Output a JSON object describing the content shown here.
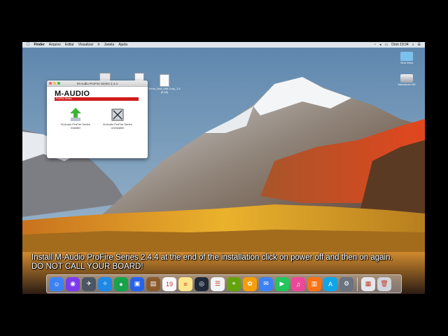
{
  "menubar": {
    "apple": "",
    "items": [
      "Finder",
      "Arquivo",
      "Editar",
      "Visualizar",
      "Ir",
      "Janela",
      "Ajuda"
    ],
    "clock": "Dom 19:34"
  },
  "desktop_icons": [
    {
      "label": "",
      "icon": "disk-image-icon"
    },
    {
      "label": "",
      "icon": "document-icon"
    },
    {
      "label": "Dmm_Bud_bb8.4.zip_1.5 (5,48)",
      "icon": "zip-icon"
    },
    {
      "label": "Sem título",
      "icon": "folder-icon"
    },
    {
      "label": "Macintosh HD",
      "icon": "hard-drive-icon"
    }
  ],
  "window": {
    "title": "M-Audio ProFire Series 2.4.4",
    "logo": "M-AUDIO",
    "banner": "ProFire Series",
    "items": [
      {
        "label": "M-Audio ProFire Series Installer",
        "icon": "installer-icon"
      },
      {
        "label": "M-Audio ProFire Series Uninstaller",
        "icon": "uninstaller-icon"
      }
    ]
  },
  "caption": {
    "line1": "Install M-Audio ProFire Series 2.4.4 at the end of the installation click on power off and then on again.",
    "line2": "DO NOT CALL YOUR BOARD!"
  },
  "dock": {
    "apps": [
      {
        "name": "finder-icon",
        "color": "#3b82f6",
        "glyph": "☺"
      },
      {
        "name": "siri-icon",
        "color": "#7c3aed",
        "glyph": "◉"
      },
      {
        "name": "launchpad-icon",
        "color": "#4b5563",
        "glyph": "✈"
      },
      {
        "name": "safari-icon",
        "color": "#1e88e5",
        "glyph": "✧"
      },
      {
        "name": "chrome-icon",
        "color": "#16a34a",
        "glyph": "●"
      },
      {
        "name": "photo-icon",
        "color": "#2563eb",
        "glyph": "▣"
      },
      {
        "name": "notes-brown-icon",
        "color": "#8b5a2b",
        "glyph": "▤"
      },
      {
        "name": "calendar-icon",
        "color": "#f9fafb",
        "glyph": "19"
      },
      {
        "name": "notes-icon",
        "color": "#fde68a",
        "glyph": "≡"
      },
      {
        "name": "quicktime-icon",
        "color": "#1f2937",
        "glyph": "◎"
      },
      {
        "name": "reminders-icon",
        "color": "#f3f4f6",
        "glyph": "☰"
      },
      {
        "name": "maps-icon",
        "color": "#65a30d",
        "glyph": "⌖"
      },
      {
        "name": "photos-icon",
        "color": "#f59e0b",
        "glyph": "✿"
      },
      {
        "name": "messages-icon",
        "color": "#3b82f6",
        "glyph": "✉"
      },
      {
        "name": "facetime-icon",
        "color": "#22c55e",
        "glyph": "▶"
      },
      {
        "name": "itunes-icon",
        "color": "#ec4899",
        "glyph": "♫"
      },
      {
        "name": "ibooks-icon",
        "color": "#f97316",
        "glyph": "▥"
      },
      {
        "name": "app-store-icon",
        "color": "#0ea5e9",
        "glyph": "A"
      },
      {
        "name": "system-preferences-icon",
        "color": "#6b7280",
        "glyph": "⚙"
      }
    ],
    "right": [
      {
        "name": "preview-icon",
        "color": "#e5e7eb",
        "glyph": "▦"
      },
      {
        "name": "trash-icon",
        "color": "#d1d5db",
        "glyph": "🗑"
      }
    ],
    "calendar_day": "19"
  }
}
